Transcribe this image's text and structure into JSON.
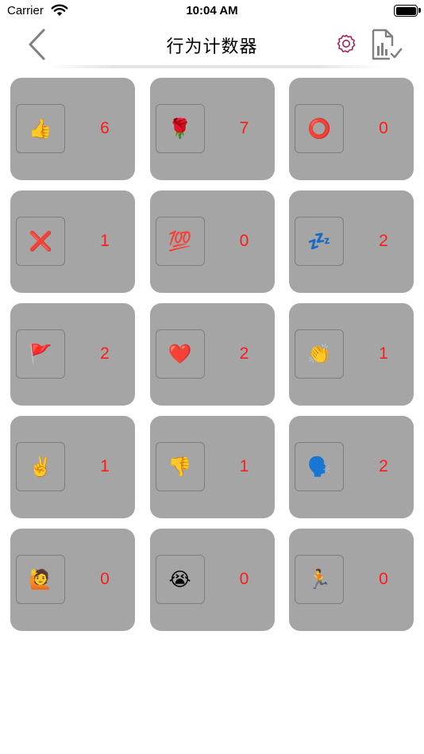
{
  "status_bar": {
    "carrier": "Carrier",
    "time": "10:04 AM"
  },
  "nav": {
    "title": "行为计数器",
    "accent_color": "#a3205a",
    "icon_gray": "#808080"
  },
  "counters": [
    {
      "icon": "thumbs-up",
      "emoji": "👍",
      "count": "6"
    },
    {
      "icon": "rose",
      "emoji": "🌹",
      "count": "7"
    },
    {
      "icon": "hollow-red-circle",
      "emoji": "⭕",
      "count": "0"
    },
    {
      "icon": "cross-mark",
      "emoji": "❌",
      "count": "1"
    },
    {
      "icon": "hundred-points",
      "emoji": "💯",
      "count": "0"
    },
    {
      "icon": "zzz",
      "emoji": "💤",
      "count": "2"
    },
    {
      "icon": "triangular-flag",
      "emoji": "🚩",
      "count": "2"
    },
    {
      "icon": "red-heart",
      "emoji": "❤️",
      "count": "2"
    },
    {
      "icon": "clapping-hands",
      "emoji": "👏",
      "count": "1"
    },
    {
      "icon": "victory-hand",
      "emoji": "✌️",
      "count": "1"
    },
    {
      "icon": "thumbs-down",
      "emoji": "👎",
      "count": "1"
    },
    {
      "icon": "speaking-head",
      "emoji": "🗣️",
      "count": "2"
    },
    {
      "icon": "person-raising-hand",
      "emoji": "🙋",
      "count": "0"
    },
    {
      "icon": "loudly-crying-face",
      "emoji": "😭",
      "count": "0"
    },
    {
      "icon": "person-running",
      "emoji": "🏃",
      "count": "0"
    }
  ],
  "colors": {
    "card_bg": "#a5a5a5",
    "count_text": "#ff1a1a"
  }
}
